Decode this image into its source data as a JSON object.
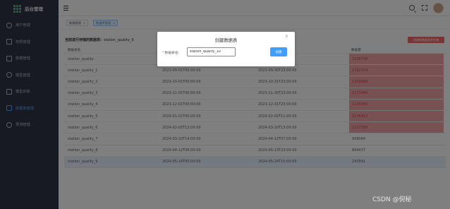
{
  "app": {
    "title": "后台管理"
  },
  "sidebar": {
    "items": [
      {
        "label": "用户管理",
        "icon": "user-icon",
        "active": false
      },
      {
        "label": "权限管理",
        "icon": "lock-icon",
        "active": false
      },
      {
        "label": "数据管理",
        "icon": "folder-icon",
        "active": false
      },
      {
        "label": "模型管理",
        "icon": "cube-icon",
        "active": false
      },
      {
        "label": "模型训练",
        "icon": "flask-icon",
        "active": false
      },
      {
        "label": "数据库管理",
        "icon": "database-icon",
        "active": true
      },
      {
        "label": "预测管理",
        "icon": "chart-icon",
        "active": false
      }
    ]
  },
  "tabs": [
    {
      "label": "数据管理",
      "active": false
    },
    {
      "label": "数据库管理",
      "active": true
    }
  ],
  "content": {
    "section_label": "当前进行存储的数据表:",
    "section_value": "station_quality_9",
    "create_button": "创建新数据表并存储",
    "columns": [
      "数据表名",
      "开始时间",
      "结束时间",
      "数据量"
    ],
    "rows": [
      {
        "name": "station_quality",
        "start": "",
        "end": "",
        "count": "1026738",
        "red": true
      },
      {
        "name": "station_quality_1",
        "start": "2023-09-01T00:00:00",
        "end": "2023-09-30T23:00:00",
        "count": "1162374",
        "red": true
      },
      {
        "name": "station_quality_2",
        "start": "2023-10-01T00:00:00",
        "end": "2023-10-31T23:00:00",
        "count": "1209666",
        "red": true
      },
      {
        "name": "station_quality_3",
        "start": "2023-11-01T00:00:00",
        "end": "2023-11-30T23:00:00",
        "count": "1171940",
        "red": true
      },
      {
        "name": "station_quality_4",
        "start": "2023-12-01T00:00:00",
        "end": "2023-12-31T23:00:00",
        "count": "1220965",
        "red": true
      },
      {
        "name": "station_quality_5",
        "start": "2024-01-01T00:00:00",
        "end": "2024-02-02T11:00:00",
        "count": "1176453",
        "red": true
      },
      {
        "name": "station_quality_6",
        "start": "2024-02-02T12:00:00",
        "end": "2024-03-10T13:00:00",
        "count": "1227356",
        "red": true
      },
      {
        "name": "station_quality_7",
        "start": "2024-03-10T14:00:00",
        "end": "2024-04-12T07:00:00",
        "count": "908084",
        "red": false
      },
      {
        "name": "station_quality_8",
        "start": "2024-04-12T08:00:00",
        "end": "2024-05-13T23:00:00",
        "count": "894437",
        "red": false
      },
      {
        "name": "station_quality_9",
        "start": "2024-05-14T00:00:00",
        "end": "2024-05-24T15:00:00",
        "count": "243991",
        "red": false,
        "highlight": true
      }
    ]
  },
  "modal": {
    "title": "创建数据表",
    "close": "×",
    "label_required": "*",
    "label": "数据表名:",
    "input_value": "station_quality_10",
    "submit": "创建"
  },
  "watermark": "CSDN @倪秘",
  "colors": {
    "sidebar_bg": "#2f3446",
    "accent": "#409eff",
    "danger_cell": "#f0a4a4",
    "danger_button": "#ef6b6b"
  }
}
